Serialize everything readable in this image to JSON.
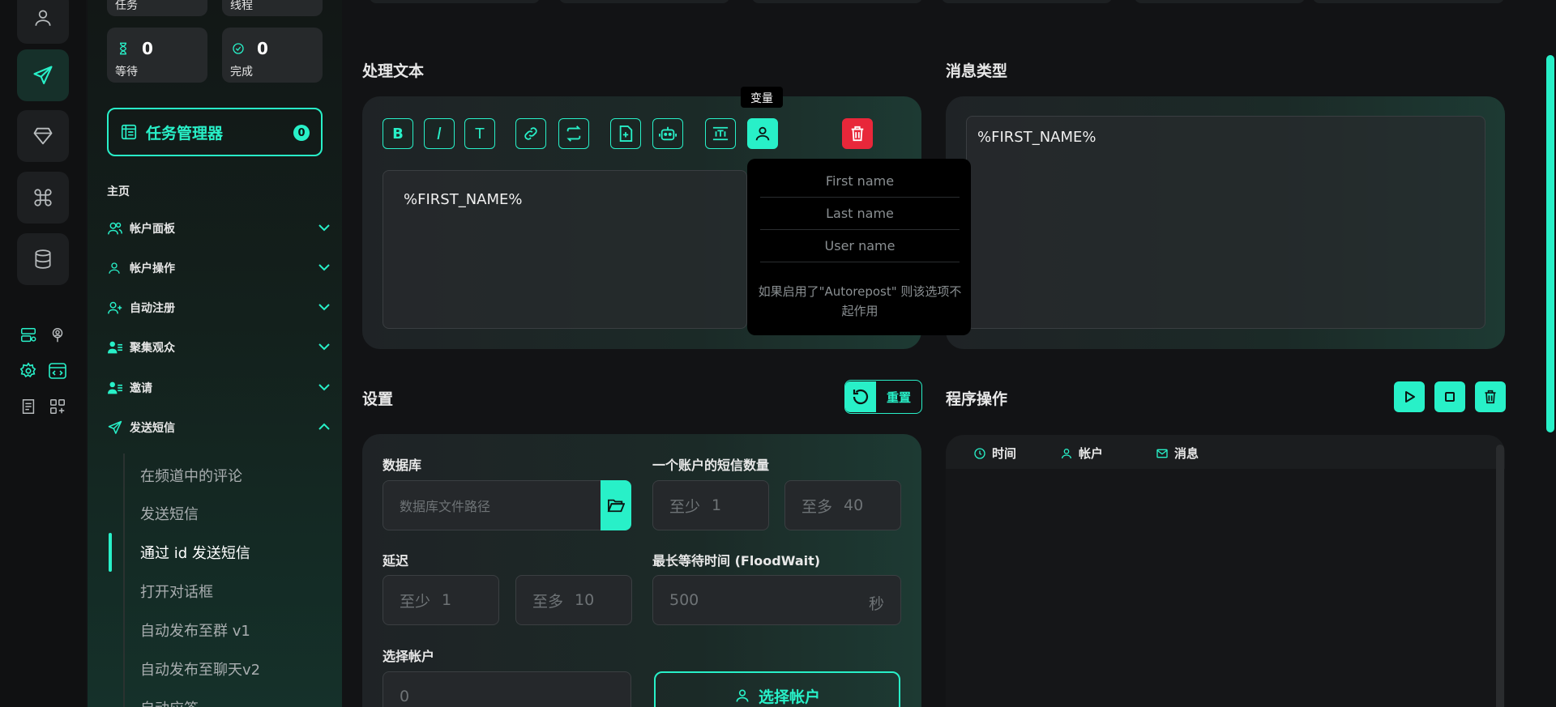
{
  "sidebar": {
    "stats": {
      "task": {
        "label": "任务"
      },
      "thread": {
        "label": "线程"
      },
      "waiting": {
        "label": "等待",
        "value": "0"
      },
      "done": {
        "label": "完成",
        "value": "0"
      }
    },
    "task_manager": {
      "label": "任务管理器",
      "count": "0"
    },
    "section_label": "主页",
    "menu": [
      {
        "label": "帐户面板"
      },
      {
        "label": "帐户操作"
      },
      {
        "label": "自动注册"
      },
      {
        "label": "聚集观众"
      },
      {
        "label": "邀请"
      },
      {
        "label": "发送短信"
      }
    ],
    "submenu": [
      {
        "label": "在频道中的评论"
      },
      {
        "label": "发送短信"
      },
      {
        "label": "通过 id 发送短信"
      },
      {
        "label": "打开对话框"
      },
      {
        "label": "自动发布至群 v1"
      },
      {
        "label": "自动发布至聊天v2"
      },
      {
        "label": "自动应答"
      }
    ]
  },
  "process_text": {
    "title": "处理文本",
    "tooltip": "变量",
    "toolbar": {
      "bold": "B",
      "italic": "I",
      "text": "T"
    },
    "editor_text": "%FIRST_NAME%",
    "variables_dropdown": {
      "items": [
        "First name",
        "Last name",
        "User name"
      ],
      "note": "如果启用了\"Autorepost\" 则该选项不起作用"
    }
  },
  "message_type": {
    "title": "消息类型",
    "editor_text": "%FIRST_NAME%"
  },
  "settings": {
    "title": "设置",
    "reset_label": "重置",
    "database": {
      "label": "数据库",
      "placeholder": "数据库文件路径"
    },
    "sms_per_account": {
      "label": "一个账户的短信数量",
      "min_prefix": "至少",
      "min_value": "1",
      "max_prefix": "至多",
      "max_value": "40"
    },
    "delay": {
      "label": "延迟",
      "min_prefix": "至少",
      "min_value": "1",
      "max_prefix": "至多",
      "max_value": "10"
    },
    "flood_wait": {
      "label": "最长等待时间 (FloodWait)",
      "value": "500",
      "suffix": "秒"
    },
    "select_account": {
      "label": "选择帐户",
      "value": "0",
      "button_label": "选择帐户"
    }
  },
  "program_ops": {
    "title": "程序操作",
    "columns": [
      "时间",
      "帐户",
      "消息"
    ]
  },
  "colors": {
    "accent": "#28f0c8",
    "danger": "#e8273a",
    "background": "#121315"
  }
}
